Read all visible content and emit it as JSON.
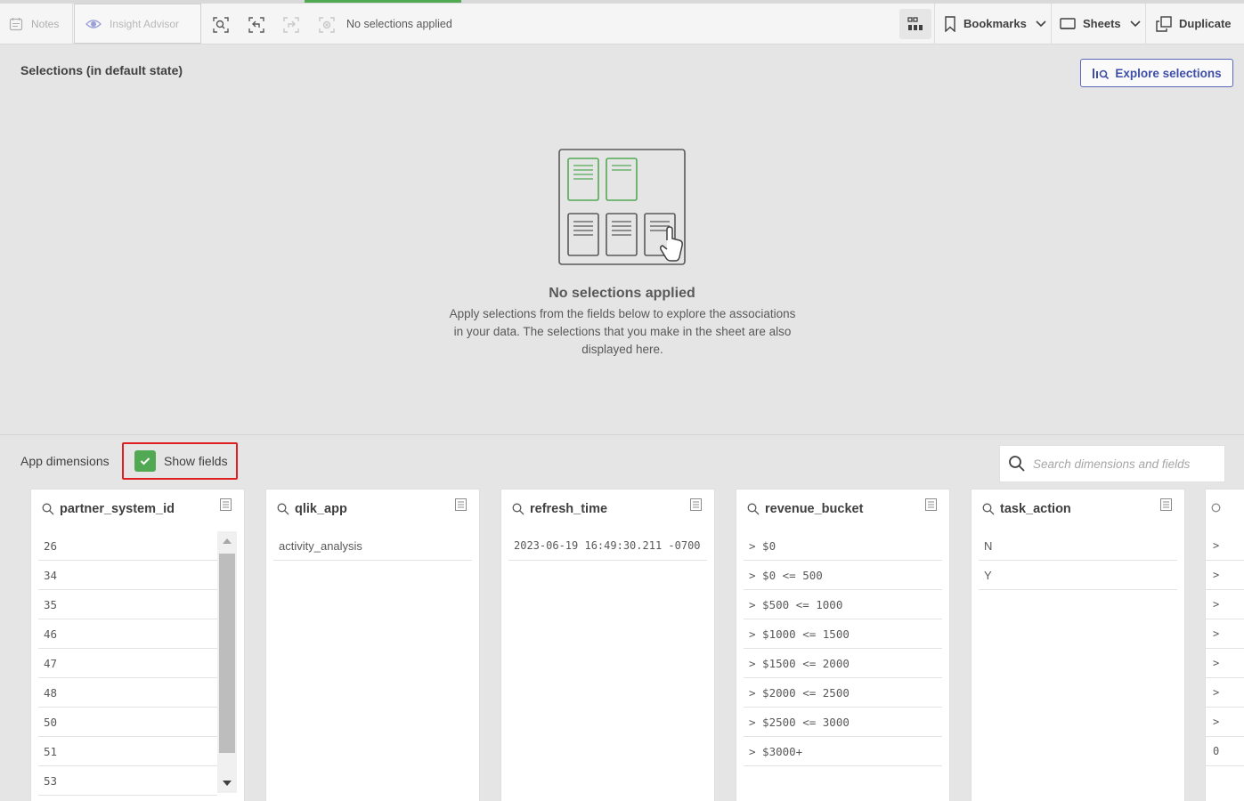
{
  "toolbar": {
    "notes_label": "Notes",
    "insight_label": "Insight Advisor",
    "no_selections_label": "No selections applied",
    "bookmarks_label": "Bookmarks",
    "sheets_label": "Sheets",
    "duplicate_label": "Duplicate"
  },
  "selections": {
    "title": "Selections (in default state)",
    "explore_label": "Explore selections",
    "empty_title": "No selections applied",
    "empty_desc": "Apply selections from the fields below to explore the associations in your data. The selections that you make in the sheet are also displayed here."
  },
  "app_dimensions": {
    "label": "App dimensions",
    "show_fields_label": "Show fields",
    "search_placeholder": "Search dimensions and fields"
  },
  "fields": [
    {
      "name": "partner_system_id",
      "values": [
        "26",
        "34",
        "35",
        "46",
        "47",
        "48",
        "50",
        "51",
        "53"
      ]
    },
    {
      "name": "qlik_app",
      "values": [
        "activity_analysis"
      ]
    },
    {
      "name": "refresh_time",
      "values": [
        "2023-06-19 16:49:30.211 -0700"
      ]
    },
    {
      "name": "revenue_bucket",
      "values": [
        "> $0",
        "> $0 <= 500",
        "> $500 <= 1000",
        "> $1000 <= 1500",
        "> $1500 <= 2000",
        "> $2000 <= 2500",
        "> $2500 <= 3000",
        "> $3000+"
      ]
    },
    {
      "name": "task_action",
      "values": [
        "N",
        "Y"
      ]
    }
  ],
  "partial_card_rows": [
    ">",
    ">",
    ">",
    ">",
    ">",
    ">",
    ">",
    "0"
  ],
  "colors": {
    "accent_green": "#52a954",
    "explore_blue": "#3f4fa8",
    "highlight_red": "#e02020"
  }
}
